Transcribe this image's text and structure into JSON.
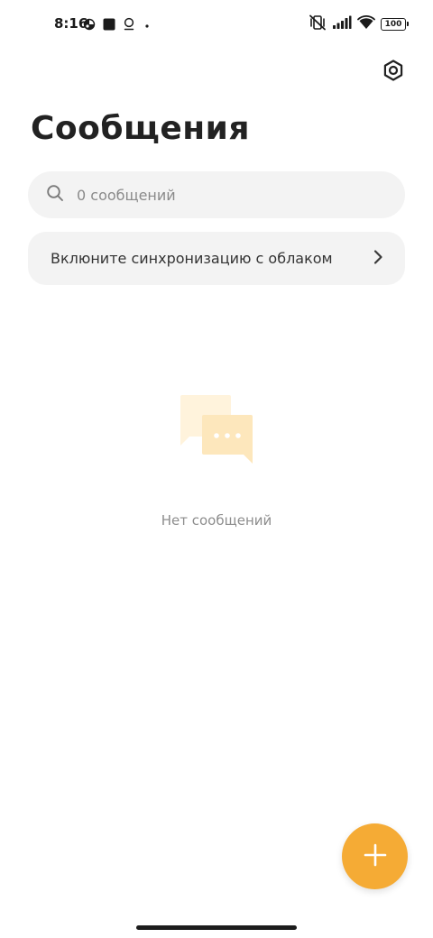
{
  "status_bar": {
    "time": "8:16",
    "battery": "100",
    "icons": [
      "notification-app-icon",
      "square-app-icon",
      "location-pin-icon",
      "more-dot-icon",
      "vibrate-mute-icon",
      "signal-icon",
      "wifi-icon",
      "battery-icon"
    ]
  },
  "header": {
    "title": "Сообщения",
    "settings_icon": "settings-icon"
  },
  "search": {
    "placeholder": "0 сообщений",
    "value": "",
    "icon": "search-icon"
  },
  "sync_banner": {
    "label": "Вклюните синхронизацию с облаком",
    "icon": "chevron-right-icon"
  },
  "empty_state": {
    "label": "Нет сообщений",
    "icon": "chat-bubbles-icon"
  },
  "fab": {
    "icon": "plus-icon"
  },
  "colors": {
    "accent": "#f5ab35",
    "surface": "#f3f3f3",
    "text_primary": "#222222",
    "text_secondary": "#8d8d8d",
    "empty_icon_light": "#fff3dc",
    "empty_icon_dark": "#fde7bc"
  }
}
